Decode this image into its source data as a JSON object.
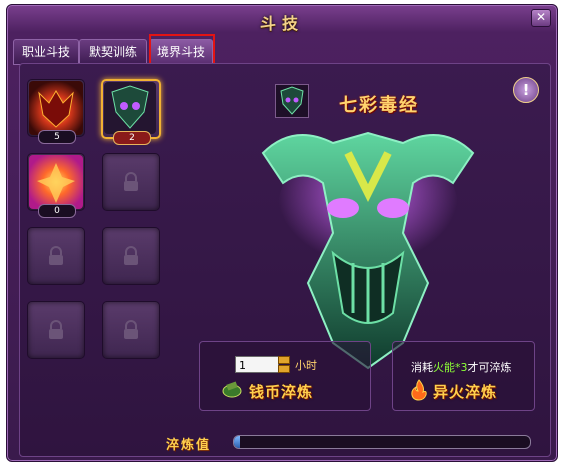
{
  "window": {
    "title": "斗技",
    "close_symbol": "✕"
  },
  "tabs": [
    {
      "label": "职业斗技",
      "active": false
    },
    {
      "label": "默契训练",
      "active": false
    },
    {
      "label": "境界斗技",
      "active": true
    }
  ],
  "slots": [
    {
      "state": "filled",
      "count": "5",
      "selected": false
    },
    {
      "state": "filled",
      "count": "2",
      "selected": true
    },
    {
      "state": "filled",
      "count": "0",
      "selected": false
    },
    {
      "state": "locked"
    },
    {
      "state": "locked"
    },
    {
      "state": "locked"
    },
    {
      "state": "locked"
    },
    {
      "state": "locked"
    }
  ],
  "info_symbol": "!",
  "skill": {
    "name": "七彩毒经"
  },
  "coin_refine": {
    "hours_value": "1",
    "hours_unit": "小时",
    "button_label": "钱币淬炼"
  },
  "fire_refine": {
    "consume_prefix": "消耗",
    "consume_item": "火能*3",
    "consume_suffix": "才可淬炼",
    "button_label": "异火淬炼"
  },
  "refine_value": {
    "label": "淬炼值",
    "progress": 0.02
  },
  "colors": {
    "accent_gold": "#ffcf4d",
    "highlight_green": "#8cff36",
    "tab_highlight_border": "#e31414"
  }
}
